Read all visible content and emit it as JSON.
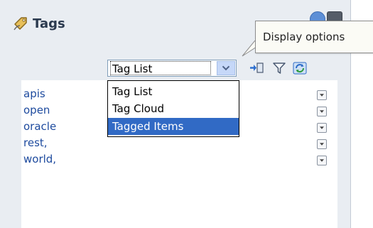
{
  "header": {
    "title": "Tags"
  },
  "tooltip": {
    "text": "Display options"
  },
  "view_select": {
    "value": "Tag List",
    "options": [
      "Tag List",
      "Tag Cloud",
      "Tagged Items"
    ],
    "highlighted": "Tagged Items"
  },
  "toolbar": {
    "icons": [
      "export-icon",
      "filter-icon",
      "refresh-icon"
    ]
  },
  "tags": [
    "apis",
    "open",
    "oracle",
    "rest,",
    "world,"
  ],
  "colors": {
    "link": "#1d4a9e",
    "selection": "#316ac5",
    "panel": "#e9edf2"
  }
}
